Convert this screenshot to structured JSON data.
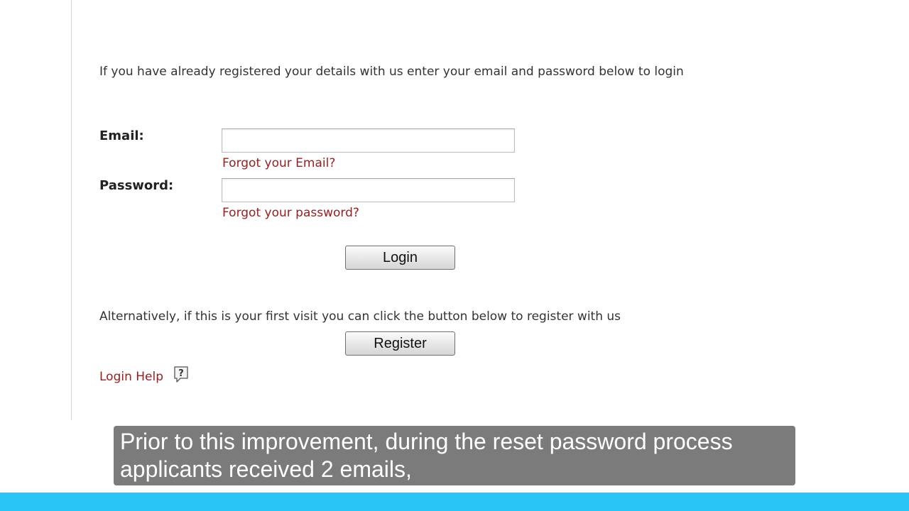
{
  "login": {
    "intro_text": "If you have already registered your details with us enter your email and password below to login",
    "email_label": "Email:",
    "email_value": "",
    "email_placeholder": "",
    "forgot_email": "Forgot your Email?",
    "password_label": "Password:",
    "password_value": "",
    "password_placeholder": "",
    "forgot_password": "Forgot your password?",
    "login_button": "Login",
    "alternative_text": "Alternatively, if this is your first visit you can click the button below to register with us",
    "register_button": "Register",
    "login_help": "Login Help",
    "help_icon": "question-speech-bubble-icon"
  },
  "caption": {
    "lines": [
      "Prior to this improvement, during the reset password process",
      "applicants received 2 emails,"
    ]
  },
  "colors": {
    "link": "#9b1c1c",
    "bottom_bar": "#29c5f6",
    "caption_background": "#646464"
  }
}
